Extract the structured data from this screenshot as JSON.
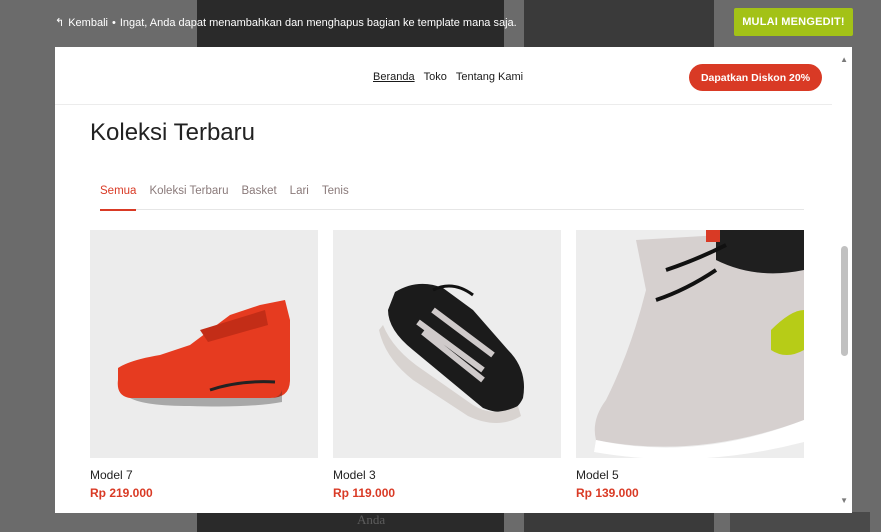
{
  "editor": {
    "back_label": "Kembali",
    "hint": "Ingat, Anda dapat menambahkan dan menghapus bagian ke template mana saja.",
    "start_button": "MULAI MENGEDIT!"
  },
  "background": {
    "ghost_text": "Anda"
  },
  "site": {
    "nav": [
      "Beranda",
      "Toko",
      "Tentang Kami"
    ],
    "promo_button": "Dapatkan Diskon 20%"
  },
  "section": {
    "title": "Koleksi Terbaru",
    "tabs": [
      "Semua",
      "Koleksi Terbaru",
      "Basket",
      "Lari",
      "Tenis"
    ],
    "active_tab": "Semua"
  },
  "products": [
    {
      "name": "Model 7",
      "price": "Rp 219.000"
    },
    {
      "name": "Model 3",
      "price": "Rp 119.000"
    },
    {
      "name": "Model 5",
      "price": "Rp 139.000"
    }
  ],
  "colors": {
    "accent": "#d93a25",
    "start_button": "#a3c217"
  }
}
